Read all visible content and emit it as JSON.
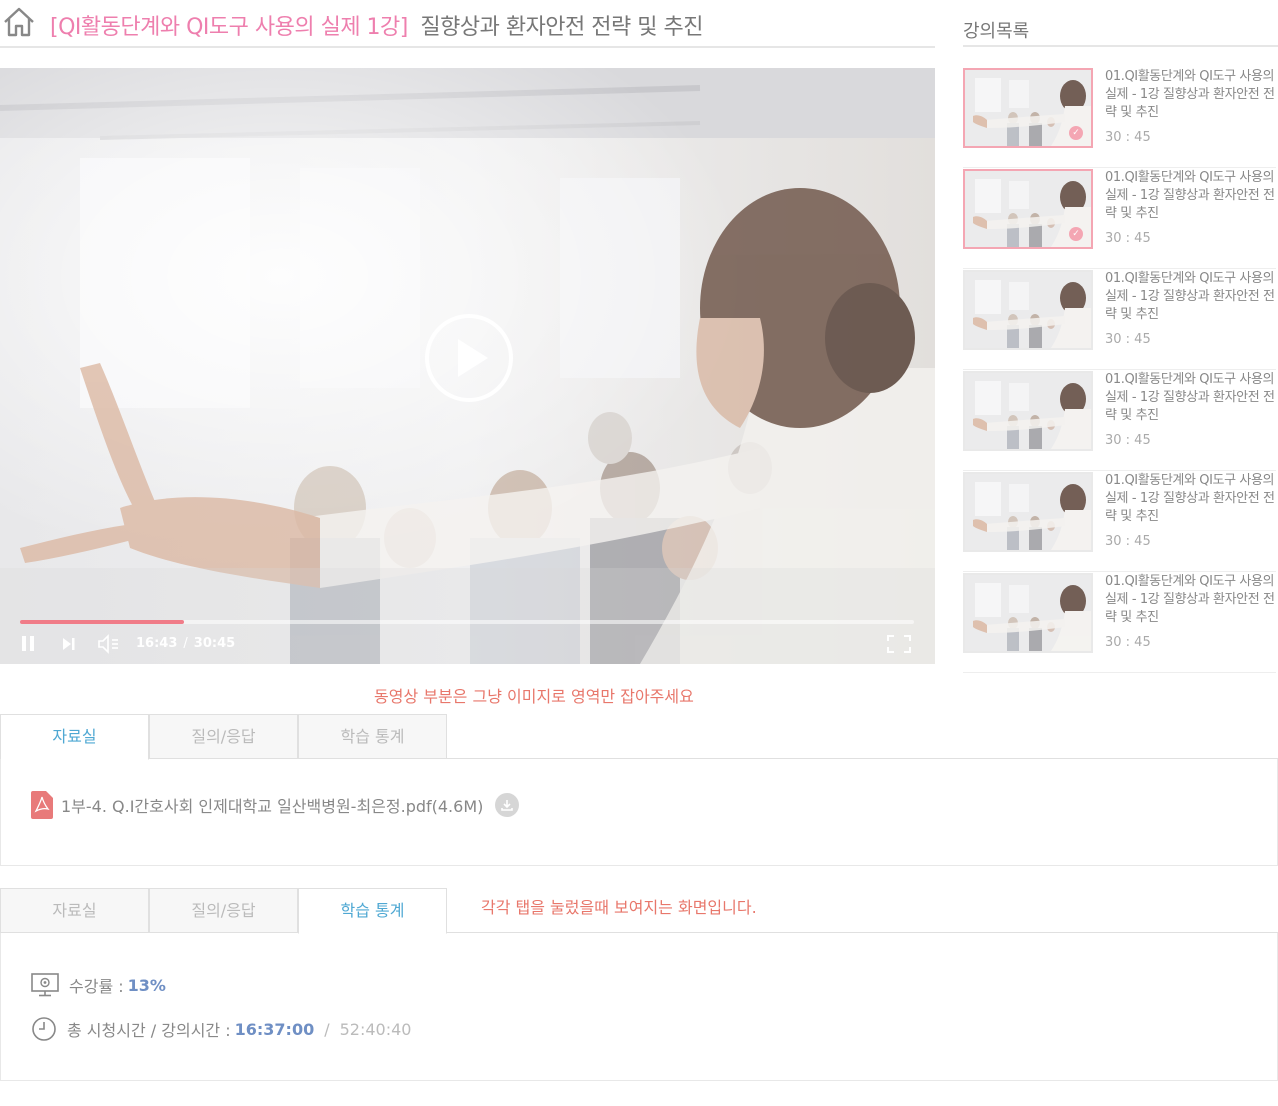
{
  "header": {
    "title_tag": "[QI활동단계와 QI도구 사용의 실제 1강]",
    "title_sub": "질향상과 환자안전 전략 및 추진"
  },
  "player": {
    "current_time": "16:43",
    "separator": "/",
    "duration": "30:45",
    "progress_fraction": 0.183
  },
  "sidebar": {
    "title": "강의목록",
    "lectures": [
      {
        "title": "01.QI활동단계와 QI도구 사용의 실제 - 1강 질향상과 환자안전 전략 및 추진",
        "duration": "30 : 45",
        "completed": true
      },
      {
        "title": "01.QI활동단계와 QI도구 사용의 실제 - 1강 질향상과 환자안전 전략 및 추진",
        "duration": "30 : 45",
        "completed": true
      },
      {
        "title": "01.QI활동단계와 QI도구 사용의 실제 - 1강 질향상과 환자안전 전략 및 추진",
        "duration": "30 : 45",
        "completed": false
      },
      {
        "title": "01.QI활동단계와 QI도구 사용의 실제 - 1강 질향상과 환자안전 전략 및 추진",
        "duration": "30 : 45",
        "completed": false
      },
      {
        "title": "01.QI활동단계와 QI도구 사용의 실제 - 1강 질향상과 환자안전 전략 및 추진",
        "duration": "30 : 45",
        "completed": false
      },
      {
        "title": "01.QI활동단계와 QI도구 사용의 실제 - 1강 질향상과 환자안전 전략 및 추진",
        "duration": "30 : 45",
        "completed": false
      }
    ]
  },
  "notices": {
    "video_note": "동영상 부분은 그냥 이미지로 영역만 잡아주세요",
    "tabs_note": "각각 탭을 눌렀을때 보여지는 화면입니다."
  },
  "tabs": {
    "materials": "자료실",
    "qna": "질의/응답",
    "stats": "학습 통계"
  },
  "materials": {
    "file_name": "1부-4. Q.I간호사회 인제대학교 일산백병원-최은정.pdf(4.6M)"
  },
  "stats": {
    "progress_label": "수강률 :",
    "progress_value": "13%",
    "time_label": "총 시청시간 / 강의시간 :",
    "watched": "16:37:00",
    "slash": "/",
    "total": "52:40:40"
  },
  "colors": {
    "accent_pink": "#ee7fae",
    "notice_red": "#e8776b",
    "tab_active_blue": "#4fa8d3",
    "stat_blue": "#6f8fc4",
    "progress_fill": "#f07c88"
  }
}
